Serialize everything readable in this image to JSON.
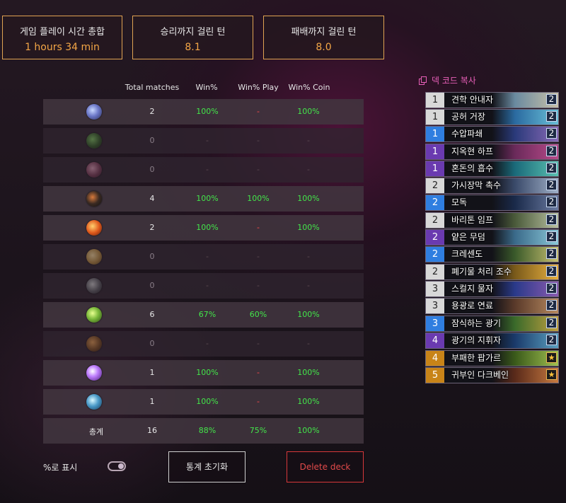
{
  "summary": [
    {
      "label": "게임 플레이 시간 총합",
      "value": "1 hours 34 min"
    },
    {
      "label": "승리까지 걸린 턴",
      "value": "8.1"
    },
    {
      "label": "패배까지 걸린 턴",
      "value": "8.0"
    }
  ],
  "table": {
    "headers": {
      "total": "Total matches",
      "win": "Win%",
      "play": "Win% Play",
      "coin": "Win% Coin"
    },
    "rows": [
      {
        "class_icon": "mage-class-icon",
        "total": "2",
        "win": "100%",
        "play": "-",
        "coin": "100%"
      },
      {
        "class_icon": "hunter-class-icon",
        "total": "0",
        "win": "-",
        "play": "-",
        "coin": "-"
      },
      {
        "class_icon": "demon-hunter-class-icon",
        "total": "0",
        "win": "-",
        "play": "-",
        "coin": "-"
      },
      {
        "class_icon": "rogue-class-icon",
        "total": "4",
        "win": "100%",
        "play": "100%",
        "coin": "100%"
      },
      {
        "class_icon": "warrior-class-icon",
        "total": "2",
        "win": "100%",
        "play": "-",
        "coin": "100%"
      },
      {
        "class_icon": "paladin-class-icon",
        "total": "0",
        "win": "-",
        "play": "-",
        "coin": "-"
      },
      {
        "class_icon": "priest-class-icon",
        "total": "0",
        "win": "-",
        "play": "-",
        "coin": "-"
      },
      {
        "class_icon": "druid-class-icon",
        "total": "6",
        "win": "67%",
        "play": "60%",
        "coin": "100%"
      },
      {
        "class_icon": "warlock-class-icon",
        "total": "0",
        "win": "-",
        "play": "-",
        "coin": "-"
      },
      {
        "class_icon": "death-knight-class-icon",
        "total": "1",
        "win": "100%",
        "play": "-",
        "coin": "100%"
      },
      {
        "class_icon": "shaman-class-icon",
        "total": "1",
        "win": "100%",
        "play": "-",
        "coin": "100%"
      }
    ],
    "total_row": {
      "label": "총계",
      "total": "16",
      "win": "88%",
      "play": "75%",
      "coin": "100%"
    }
  },
  "controls": {
    "percent_toggle_label": "%로 표시",
    "reset_button": "통계 초기화",
    "delete_button": "Delete deck"
  },
  "deck": {
    "copy_label": "덱 코드 복사",
    "cards": [
      {
        "cost": "1",
        "name": "견학 안내자",
        "count": "2"
      },
      {
        "cost": "1",
        "name": "공허 거장",
        "count": "2"
      },
      {
        "cost": "1",
        "name": "수압파쇄",
        "count": "2"
      },
      {
        "cost": "1",
        "name": "지옥현 하프",
        "count": "2"
      },
      {
        "cost": "1",
        "name": "혼돈의 흡수",
        "count": "2"
      },
      {
        "cost": "2",
        "name": "가시장막 촉수",
        "count": "2"
      },
      {
        "cost": "2",
        "name": "모독",
        "count": "2"
      },
      {
        "cost": "2",
        "name": "바리톤 임프",
        "count": "2"
      },
      {
        "cost": "2",
        "name": "얕은 무덤",
        "count": "2"
      },
      {
        "cost": "2",
        "name": "크레센도",
        "count": "2"
      },
      {
        "cost": "2",
        "name": "폐기물 처리 조수",
        "count": "2"
      },
      {
        "cost": "3",
        "name": "스컬지 물자",
        "count": "2"
      },
      {
        "cost": "3",
        "name": "용광로 연료",
        "count": "2"
      },
      {
        "cost": "3",
        "name": "잠식하는 광기",
        "count": "2"
      },
      {
        "cost": "4",
        "name": "광기의 지휘자",
        "count": "2"
      },
      {
        "cost": "4",
        "name": "부패한 팝가르",
        "count": "★"
      },
      {
        "cost": "5",
        "name": "귀부인 다크베인",
        "count": "★"
      }
    ]
  },
  "colors": {
    "accent_orange": "#f3a646",
    "win_green": "#43e64a",
    "dash_red": "#ff4a4a",
    "copy_pink": "#e85fb8",
    "delete_red": "#d8383a"
  }
}
